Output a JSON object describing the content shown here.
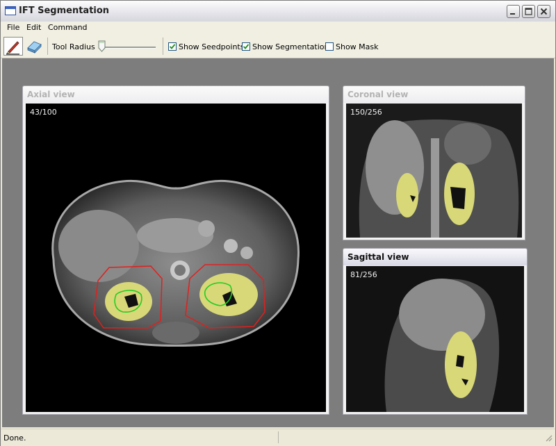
{
  "window": {
    "title": "IFT Segmentation"
  },
  "menu": {
    "items": [
      "File",
      "Edit",
      "Command"
    ]
  },
  "toolbar": {
    "tool_radius_label": "Tool Radius",
    "tool_radius_value": 0,
    "show_seedpoints": {
      "label": "Show Seedpoints",
      "checked": true
    },
    "show_segmentation": {
      "label": "Show Segmentation",
      "checked": true
    },
    "show_mask": {
      "label": "Show Mask",
      "checked": false
    }
  },
  "views": {
    "axial": {
      "title": "Axial view",
      "slice": "43/100",
      "active": false
    },
    "coronal": {
      "title": "Coronal view",
      "slice": "150/256",
      "active": false
    },
    "sagittal": {
      "title": "Sagittal view",
      "slice": "81/256",
      "active": true
    }
  },
  "status": {
    "text": "Done."
  },
  "colors": {
    "segmentation": "#d8d878",
    "seed_outer": "#e0201e",
    "seed_inner": "#22cc22"
  }
}
